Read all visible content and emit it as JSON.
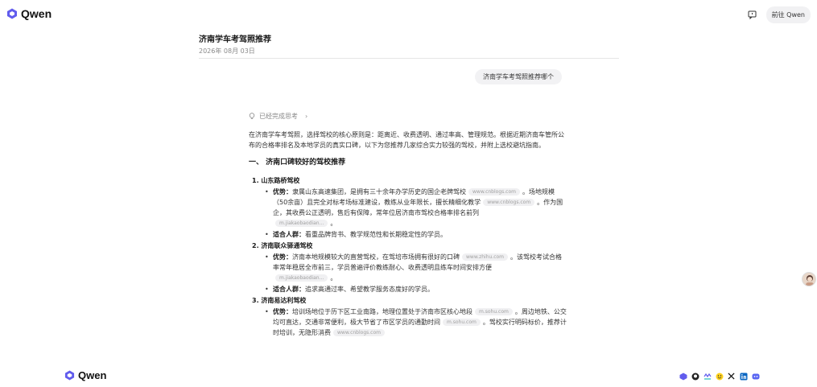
{
  "brand": {
    "name": "Qwen",
    "color": "#615ced"
  },
  "top_right": {
    "goto_label": "前往 Qwen",
    "feedback_icon": "feedback-icon"
  },
  "chat": {
    "title": "济南学车考驾照推荐",
    "date": "2026年 08月 03日"
  },
  "user_message": "济南学车考驾照推荐哪个",
  "answer": {
    "thinking_label": "已经完成思考",
    "intro": "在济南学车考驾照，选择驾校的核心原则是：距离近、收费透明、通过率高、管理规范。根据近期济南车管所公布的合格率排名及本地学员的真实口碑，以下为您推荐几家综合实力较强的驾校，并附上选校避坑指南。",
    "section_title": "一、 济南口碑较好的驾校推荐",
    "schools": [
      {
        "name": "1. 山东路桥驾校",
        "bullets": [
          {
            "label": "优势：",
            "text": "隶属山东高速集团，是拥有三十余年办学历史的国企老牌驾校",
            "cite": "www.cnblogs.com",
            "rest": "。场地规模（50余亩）且完全对标考场标准建设，教练从业年限长，擅长精细化教学",
            "cite2": "www.cnblogs.com",
            "rest2": "。作为国企，其收费公正透明，售后有保障，常年位居济南市驾校合格率排名前列",
            "cite3": "m.jiakaobaodian..."
          },
          {
            "label": "适合人群：",
            "text": "看重品牌背书、教学规范性和长期稳定性的学员。"
          }
        ]
      },
      {
        "name": "2. 济南联众驿通驾校",
        "bullets": [
          {
            "label": "优势：",
            "text": "济南本地规模较大的直营驾校，在驾培市场拥有很好的口碑",
            "cite": "www.zhihu.com",
            "rest": "。该驾校考试合格率常年稳居全市前三，学员普遍评价教练耐心、收费透明且练车时间安排方便",
            "cite2": "m.jiakaobaodian...",
            "rest2": "。"
          },
          {
            "label": "适合人群：",
            "text": "追求高通过率、希望教学服务态度好的学员。"
          }
        ]
      },
      {
        "name": "3. 济南易达利驾校",
        "bullets": [
          {
            "label": "优势：",
            "text": "培训场地位于历下区工业南路，地理位置处于济南市区核心地段",
            "cite": "m.sohu.com",
            "rest": "。周边地铁、公交均可直达，交通非常便利，极大节省了市区学员的通勤时间",
            "cite2": "m.sohu.com",
            "rest2": "。驾校实行明码标价，推荐计时培训，无隐形消费",
            "cite3": "www.cnblogs.com"
          }
        ]
      }
    ]
  },
  "footer": {
    "brand": "Qwen",
    "social_icons": [
      "qwen-icon",
      "github-icon",
      "modelscope-icon",
      "huggingface-icon",
      "x-icon",
      "linkedin-icon",
      "discord-icon"
    ]
  }
}
